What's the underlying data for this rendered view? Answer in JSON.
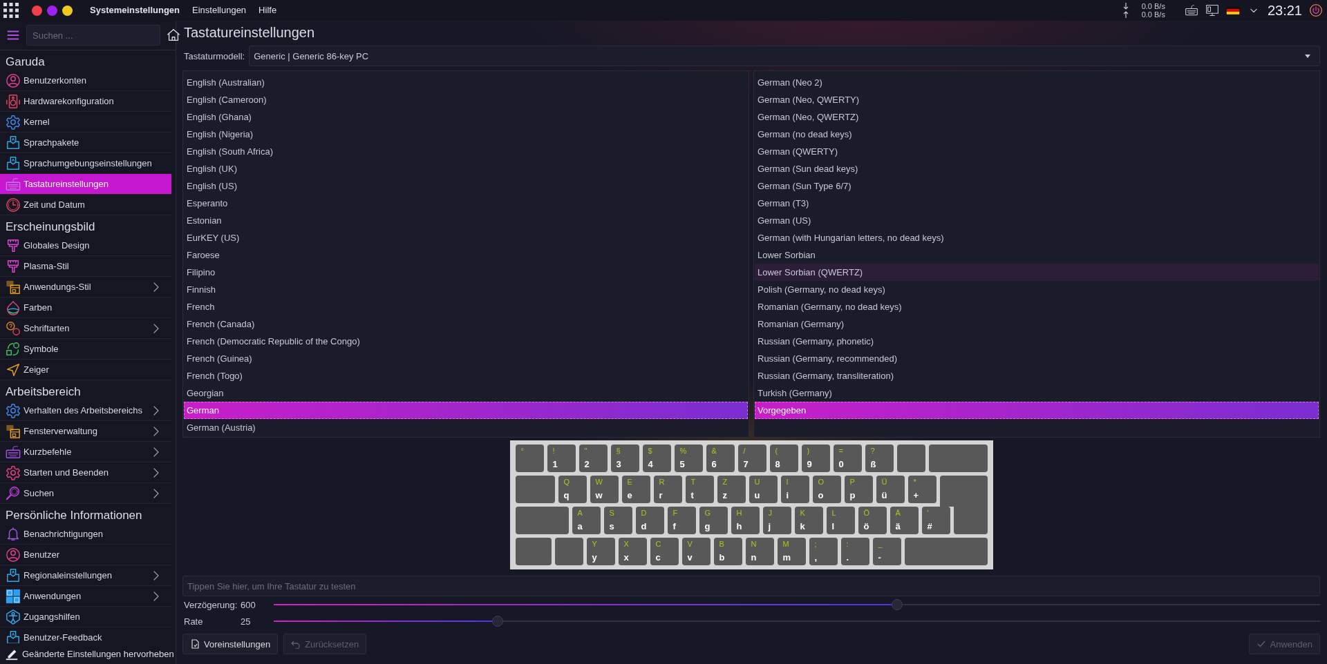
{
  "top_bar": {
    "menus": [
      {
        "label": "Systemeinstellungen",
        "kind": "app"
      },
      {
        "label": "Einstellungen",
        "kind": "menu"
      },
      {
        "label": "Hilfe",
        "kind": "menu"
      }
    ],
    "network": {
      "down": "0.0 B/s",
      "up": "0.0 B/s"
    },
    "clock": "23:21"
  },
  "sidebar": {
    "search": {
      "placeholder": "Suchen ..."
    },
    "sections": [
      {
        "title": "Garuda",
        "items": [
          {
            "label": "Benutzerkonten",
            "selected": false,
            "expandable": false
          },
          {
            "label": "Hardwarekonfiguration",
            "selected": false,
            "expandable": false
          },
          {
            "label": "Kernel",
            "selected": false,
            "expandable": false
          },
          {
            "label": "Sprachpakete",
            "selected": false,
            "expandable": false
          },
          {
            "label": "Sprachumgebungseinstellungen",
            "selected": false,
            "expandable": false
          },
          {
            "label": "Tastatureinstellungen",
            "selected": true,
            "expandable": false
          },
          {
            "label": "Zeit und Datum",
            "selected": false,
            "expandable": false
          }
        ]
      },
      {
        "title": "Erscheinungsbild",
        "items": [
          {
            "label": "Globales Design",
            "selected": false,
            "expandable": false
          },
          {
            "label": "Plasma-Stil",
            "selected": false,
            "expandable": false
          },
          {
            "label": "Anwendungs-Stil",
            "selected": false,
            "expandable": true
          },
          {
            "label": "Farben",
            "selected": false,
            "expandable": false
          },
          {
            "label": "Schriftarten",
            "selected": false,
            "expandable": true
          },
          {
            "label": "Symbole",
            "selected": false,
            "expandable": false
          },
          {
            "label": "Zeiger",
            "selected": false,
            "expandable": false
          }
        ]
      },
      {
        "title": "Arbeitsbereich",
        "items": [
          {
            "label": "Verhalten des Arbeitsbereichs",
            "selected": false,
            "expandable": true
          },
          {
            "label": "Fensterverwaltung",
            "selected": false,
            "expandable": true
          },
          {
            "label": "Kurzbefehle",
            "selected": false,
            "expandable": true
          },
          {
            "label": "Starten und Beenden",
            "selected": false,
            "expandable": true
          },
          {
            "label": "Suchen",
            "selected": false,
            "expandable": true
          }
        ]
      },
      {
        "title": "Persönliche Informationen",
        "items": [
          {
            "label": "Benachrichtigungen",
            "selected": false,
            "expandable": false
          },
          {
            "label": "Benutzer",
            "selected": false,
            "expandable": false
          },
          {
            "label": "Regionaleinstellungen",
            "selected": false,
            "expandable": true
          },
          {
            "label": "Anwendungen",
            "selected": false,
            "expandable": true
          },
          {
            "label": "Zugangshilfen",
            "selected": false,
            "expandable": false
          },
          {
            "label": "Benutzer-Feedback",
            "selected": false,
            "expandable": false
          }
        ]
      }
    ],
    "footer": "Geänderte Einstellungen hervorheben"
  },
  "page": {
    "title": "Tastatureinstellungen",
    "model": {
      "label": "Tastaturmodell:",
      "value": "Generic | Generic 86-key PC"
    },
    "layouts": [
      {
        "label": "English (Australian)",
        "selected": false
      },
      {
        "label": "English (Cameroon)",
        "selected": false
      },
      {
        "label": "English (Ghana)",
        "selected": false
      },
      {
        "label": "English (Nigeria)",
        "selected": false
      },
      {
        "label": "English (South Africa)",
        "selected": false
      },
      {
        "label": "English (UK)",
        "selected": false
      },
      {
        "label": "English (US)",
        "selected": false
      },
      {
        "label": "Esperanto",
        "selected": false
      },
      {
        "label": "Estonian",
        "selected": false
      },
      {
        "label": "EurKEY (US)",
        "selected": false
      },
      {
        "label": "Faroese",
        "selected": false
      },
      {
        "label": "Filipino",
        "selected": false
      },
      {
        "label": "Finnish",
        "selected": false
      },
      {
        "label": "French",
        "selected": false
      },
      {
        "label": "French (Canada)",
        "selected": false
      },
      {
        "label": "French (Democratic Republic of the Congo)",
        "selected": false
      },
      {
        "label": "French (Guinea)",
        "selected": false
      },
      {
        "label": "French (Togo)",
        "selected": false
      },
      {
        "label": "Georgian",
        "selected": false
      },
      {
        "label": "German",
        "selected": true
      },
      {
        "label": "German (Austria)",
        "selected": false
      }
    ],
    "variants": [
      {
        "label": "German (Neo 2)",
        "selected": false,
        "hovered": false
      },
      {
        "label": "German (Neo, QWERTY)",
        "selected": false,
        "hovered": false
      },
      {
        "label": "German (Neo, QWERTZ)",
        "selected": false,
        "hovered": false
      },
      {
        "label": "German (no dead keys)",
        "selected": false,
        "hovered": false
      },
      {
        "label": "German (QWERTY)",
        "selected": false,
        "hovered": false
      },
      {
        "label": "German (Sun dead keys)",
        "selected": false,
        "hovered": false
      },
      {
        "label": "German (Sun Type 6/7)",
        "selected": false,
        "hovered": false
      },
      {
        "label": "German (T3)",
        "selected": false,
        "hovered": false
      },
      {
        "label": "German (US)",
        "selected": false,
        "hovered": false
      },
      {
        "label": "German (with Hungarian letters, no dead keys)",
        "selected": false,
        "hovered": false
      },
      {
        "label": "Lower Sorbian",
        "selected": false,
        "hovered": false
      },
      {
        "label": "Lower Sorbian (QWERTZ)",
        "selected": false,
        "hovered": true
      },
      {
        "label": "Polish (Germany, no dead keys)",
        "selected": false,
        "hovered": false
      },
      {
        "label": "Romanian (Germany, no dead keys)",
        "selected": false,
        "hovered": false
      },
      {
        "label": "Romanian (Germany)",
        "selected": false,
        "hovered": false
      },
      {
        "label": "Russian (Germany, phonetic)",
        "selected": false,
        "hovered": false
      },
      {
        "label": "Russian (Germany, recommended)",
        "selected": false,
        "hovered": false
      },
      {
        "label": "Russian (Germany, transliteration)",
        "selected": false,
        "hovered": false
      },
      {
        "label": "Turkish (Germany)",
        "selected": false,
        "hovered": false
      },
      {
        "label": "Vorgegeben",
        "selected": true,
        "hovered": false
      }
    ],
    "keyboard": {
      "rows": [
        [
          {
            "kind": "char",
            "shift": "°"
          },
          {
            "kind": "char",
            "shift": "!",
            "base": "1"
          },
          {
            "kind": "char",
            "shift": "\"",
            "base": "2"
          },
          {
            "kind": "char",
            "shift": "§",
            "base": "3"
          },
          {
            "kind": "char",
            "shift": "$",
            "base": "4"
          },
          {
            "kind": "char",
            "shift": "%",
            "base": "5"
          },
          {
            "kind": "char",
            "shift": "&",
            "base": "6"
          },
          {
            "kind": "char",
            "shift": "/",
            "base": "7"
          },
          {
            "kind": "char",
            "shift": "(",
            "base": "8"
          },
          {
            "kind": "char",
            "shift": ")",
            "base": "9"
          },
          {
            "kind": "char",
            "shift": "=",
            "base": "0"
          },
          {
            "kind": "char",
            "shift": "?",
            "base": "ß"
          },
          {
            "kind": "blank"
          },
          {
            "kind": "backspace"
          }
        ],
        [
          {
            "kind": "tab"
          },
          {
            "kind": "char",
            "shift": "Q",
            "base": "q"
          },
          {
            "kind": "char",
            "shift": "W",
            "base": "w"
          },
          {
            "kind": "char",
            "shift": "E",
            "base": "e"
          },
          {
            "kind": "char",
            "shift": "R",
            "base": "r"
          },
          {
            "kind": "char",
            "shift": "T",
            "base": "t"
          },
          {
            "kind": "char",
            "shift": "Z",
            "base": "z"
          },
          {
            "kind": "char",
            "shift": "U",
            "base": "u"
          },
          {
            "kind": "char",
            "shift": "I",
            "base": "i"
          },
          {
            "kind": "char",
            "shift": "O",
            "base": "o"
          },
          {
            "kind": "char",
            "shift": "P",
            "base": "p"
          },
          {
            "kind": "char",
            "shift": "Ü",
            "base": "ü"
          },
          {
            "kind": "char",
            "shift": "*",
            "base": "+"
          },
          {
            "kind": "enter-top"
          }
        ],
        [
          {
            "kind": "caps"
          },
          {
            "kind": "char",
            "shift": "A",
            "base": "a"
          },
          {
            "kind": "char",
            "shift": "S",
            "base": "s"
          },
          {
            "kind": "char",
            "shift": "D",
            "base": "d"
          },
          {
            "kind": "char",
            "shift": "F",
            "base": "f"
          },
          {
            "kind": "char",
            "shift": "G",
            "base": "g"
          },
          {
            "kind": "char",
            "shift": "H",
            "base": "h"
          },
          {
            "kind": "char",
            "shift": "J",
            "base": "j"
          },
          {
            "kind": "char",
            "shift": "K",
            "base": "k"
          },
          {
            "kind": "char",
            "shift": "L",
            "base": "l"
          },
          {
            "kind": "char",
            "shift": "Ö",
            "base": "ö"
          },
          {
            "kind": "char",
            "shift": "Ä",
            "base": "ä"
          },
          {
            "kind": "char",
            "shift": "'",
            "base": "#"
          },
          {
            "kind": "enter-bottom"
          }
        ],
        [
          {
            "kind": "shift"
          },
          {
            "kind": "blank"
          },
          {
            "kind": "char",
            "shift": "Y",
            "base": "y"
          },
          {
            "kind": "char",
            "shift": "X",
            "base": "x"
          },
          {
            "kind": "char",
            "shift": "C",
            "base": "c"
          },
          {
            "kind": "char",
            "shift": "V",
            "base": "v"
          },
          {
            "kind": "char",
            "shift": "B",
            "base": "b"
          },
          {
            "kind": "char",
            "shift": "N",
            "base": "n"
          },
          {
            "kind": "char",
            "shift": "M",
            "base": "m"
          },
          {
            "kind": "char",
            "shift": ";",
            "base": ","
          },
          {
            "kind": "char",
            "shift": ":",
            "base": "."
          },
          {
            "kind": "char",
            "shift": "_",
            "base": "-"
          },
          {
            "kind": "shift-right"
          }
        ]
      ]
    },
    "test_field": {
      "placeholder": "Tippen Sie hier, um Ihre Tastatur zu testen"
    },
    "sliders": [
      {
        "label": "Verzögerung:",
        "reading": "600",
        "level": 0.596
      },
      {
        "label": "Rate",
        "reading": "25",
        "level": 0.214
      }
    ],
    "buttons": [
      {
        "label": "Voreinstellungen",
        "disabled": false
      },
      {
        "label": "Zurücksetzen",
        "disabled": true
      },
      {
        "label": "Anwenden",
        "disabled": true
      }
    ]
  }
}
